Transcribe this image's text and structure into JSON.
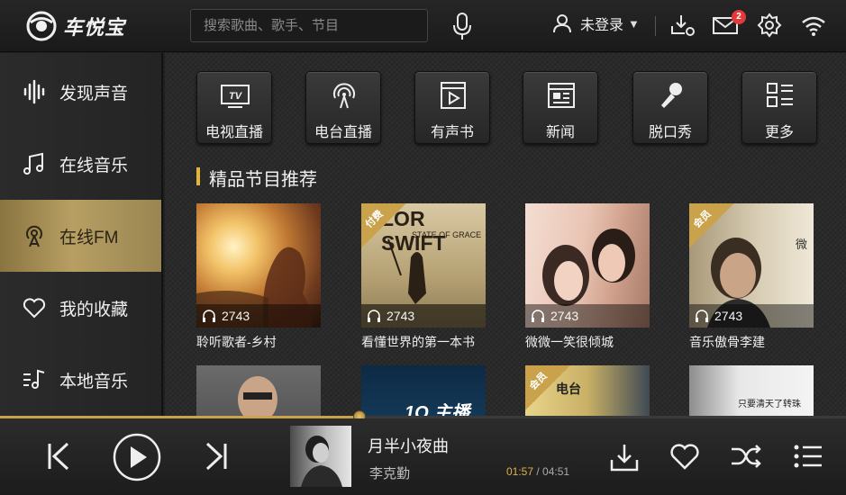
{
  "app": {
    "name": "车悦宝"
  },
  "header": {
    "search_placeholder": "搜索歌曲、歌手、节目",
    "user_label": "未登录",
    "mail_badge": "2"
  },
  "sidebar": {
    "items": [
      {
        "label": "发现声音",
        "icon": "sound-wave-icon",
        "active": false
      },
      {
        "label": "在线音乐",
        "icon": "music-note-icon",
        "active": false
      },
      {
        "label": "在线FM",
        "icon": "radio-broadcast-icon",
        "active": true
      },
      {
        "label": "我的收藏",
        "icon": "heart-icon",
        "active": false
      },
      {
        "label": "本地音乐",
        "icon": "local-music-icon",
        "active": false
      }
    ]
  },
  "categories": [
    {
      "label": "电视直播",
      "icon": "tv-icon"
    },
    {
      "label": "电台直播",
      "icon": "radio-icon"
    },
    {
      "label": "有声书",
      "icon": "audiobook-icon"
    },
    {
      "label": "新闻",
      "icon": "news-icon"
    },
    {
      "label": "脱口秀",
      "icon": "microphone-icon"
    },
    {
      "label": "更多",
      "icon": "more-icon"
    }
  ],
  "section": {
    "title": "精品节目推荐"
  },
  "cards": [
    {
      "title": "聆听歌者-乡村",
      "plays": "2743",
      "tag": "",
      "art_text": ""
    },
    {
      "title": "看懂世界的第一本书",
      "plays": "2743",
      "tag": "付费",
      "art_text": "LOR SWIFT",
      "art_sub": "STATE OF GRACE"
    },
    {
      "title": "微微一笑很倾城",
      "plays": "2743",
      "tag": "",
      "art_text": ""
    },
    {
      "title": "音乐傲骨李建",
      "plays": "2743",
      "tag": "会员",
      "art_text": ""
    },
    {
      "title": "",
      "plays": "",
      "tag": "",
      "art_text": ""
    },
    {
      "title": "",
      "plays": "",
      "tag": "",
      "art_text": "1Q 主播"
    },
    {
      "title": "",
      "plays": "",
      "tag": "会员",
      "art_text": "电台"
    },
    {
      "title": "",
      "plays": "",
      "tag": "",
      "art_text": "只要清天了转珠"
    }
  ],
  "player": {
    "song_title": "月半小夜曲",
    "artist": "李克勤",
    "current_time": "01:57",
    "total_time": "04:51",
    "progress": 0.425
  },
  "colors": {
    "accent": "#c9a24b",
    "badge": "#e23a3a"
  }
}
